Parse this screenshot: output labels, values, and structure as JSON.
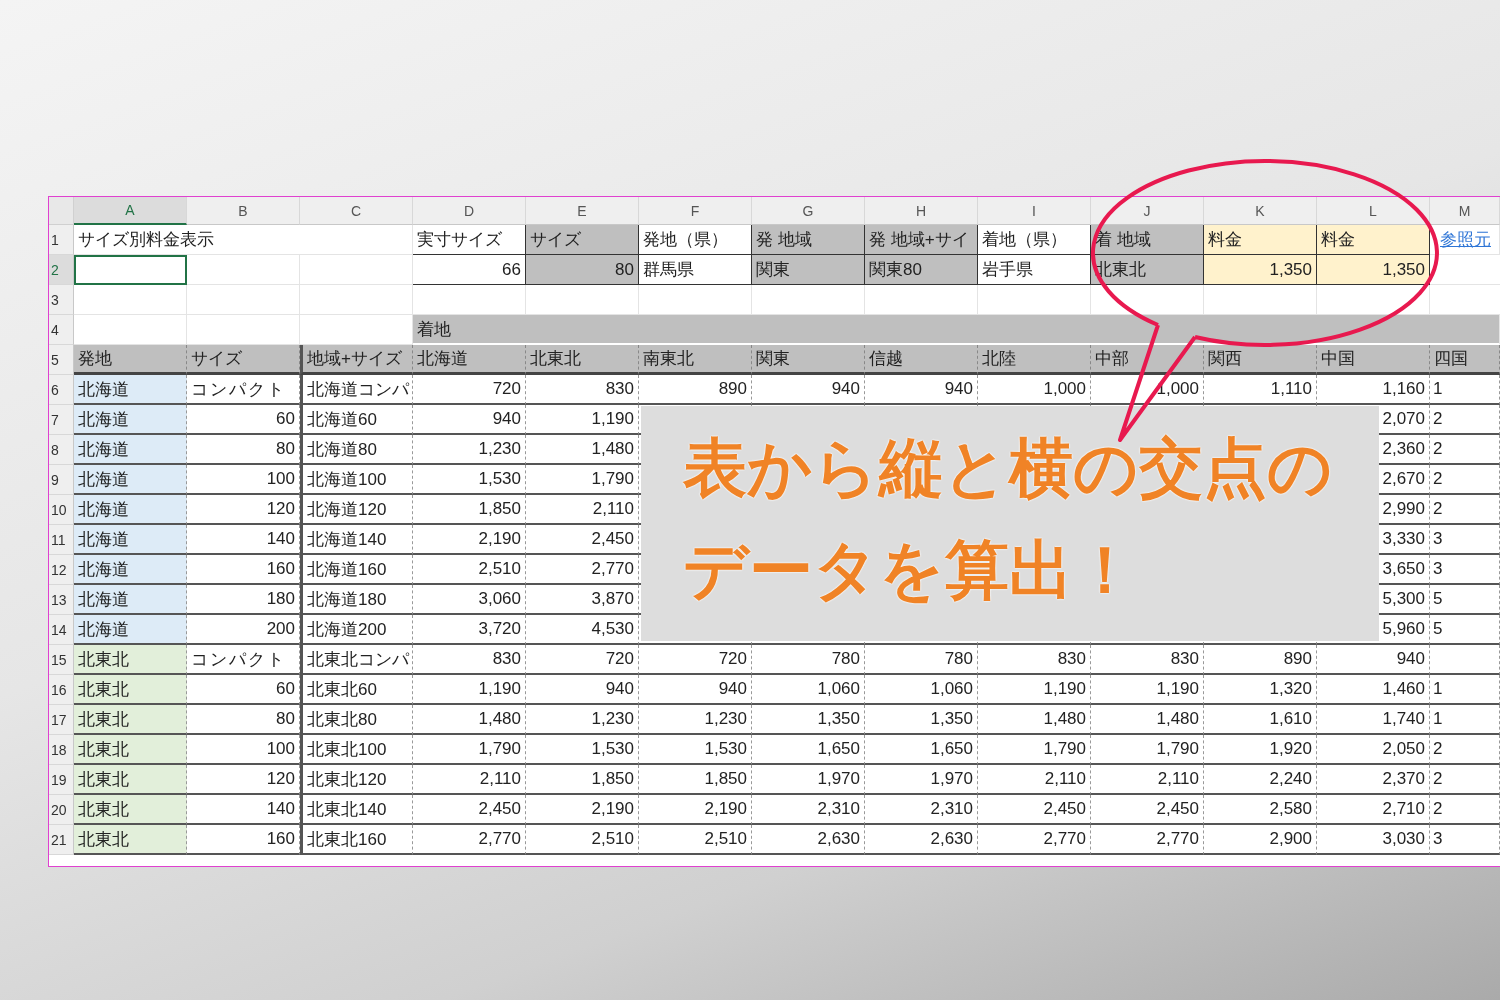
{
  "columns": [
    {
      "label": "A",
      "selected": true
    },
    {
      "label": "B",
      "selected": false
    },
    {
      "label": "C",
      "selected": false
    },
    {
      "label": "D",
      "selected": false
    },
    {
      "label": "E",
      "selected": false
    },
    {
      "label": "F",
      "selected": false
    },
    {
      "label": "G",
      "selected": false
    },
    {
      "label": "H",
      "selected": false
    },
    {
      "label": "I",
      "selected": false
    },
    {
      "label": "J",
      "selected": false
    },
    {
      "label": "K",
      "selected": false
    },
    {
      "label": "L",
      "selected": false
    },
    {
      "label": "M",
      "selected": false
    }
  ],
  "top_rows": [
    {
      "num": "1",
      "selected": false,
      "cells": [
        {
          "kind": "title",
          "text": "サイズ別料金表示"
        },
        {
          "kind": "blank"
        },
        {
          "kind": "blank"
        },
        {
          "kind": "input",
          "text": "実寸サイズ"
        },
        {
          "kind": "lookup",
          "text": "サイズ"
        },
        {
          "kind": "input",
          "text": "発地（県）"
        },
        {
          "kind": "lookup",
          "text": "発 地域"
        },
        {
          "kind": "lookup",
          "text": "発 地域+サイ"
        },
        {
          "kind": "input",
          "text": "着地（県）"
        },
        {
          "kind": "lookup",
          "text": "着 地域"
        },
        {
          "kind": "fare",
          "text": "料金"
        },
        {
          "kind": "fare",
          "text": "料金"
        },
        {
          "kind": "link",
          "text": "参照元"
        }
      ]
    },
    {
      "num": "2",
      "selected": true,
      "cells": [
        {
          "kind": "blank"
        },
        {
          "kind": "blank"
        },
        {
          "kind": "blank"
        },
        {
          "kind": "input-number",
          "text": "66"
        },
        {
          "kind": "lookup-number",
          "text": "80"
        },
        {
          "kind": "input",
          "text": "群馬県"
        },
        {
          "kind": "lookup",
          "text": "関東"
        },
        {
          "kind": "lookup",
          "text": "関東80"
        },
        {
          "kind": "input",
          "text": "岩手県"
        },
        {
          "kind": "lookup",
          "text": "北東北"
        },
        {
          "kind": "fare-number",
          "text": "1,350"
        },
        {
          "kind": "fare-number",
          "text": "1,350"
        },
        {
          "kind": "blank"
        }
      ]
    },
    {
      "num": "3",
      "selected": false,
      "cells": []
    },
    {
      "num": "4",
      "selected": false,
      "cells": [
        {
          "kind": "blank"
        },
        {
          "kind": "blank"
        },
        {
          "kind": "blank"
        },
        {
          "kind": "band",
          "text": "着地"
        }
      ]
    },
    {
      "num": "5",
      "selected": false,
      "cells": [
        {
          "kind": "head",
          "text": "発地"
        },
        {
          "kind": "head",
          "text": "サイズ"
        },
        {
          "kind": "head",
          "text": "地域+サイズ"
        },
        {
          "kind": "head",
          "text": "北海道"
        },
        {
          "kind": "head",
          "text": "北東北"
        },
        {
          "kind": "head",
          "text": "南東北"
        },
        {
          "kind": "head",
          "text": "関東"
        },
        {
          "kind": "head",
          "text": "信越"
        },
        {
          "kind": "head",
          "text": "北陸"
        },
        {
          "kind": "head",
          "text": "中部"
        },
        {
          "kind": "head",
          "text": "関西"
        },
        {
          "kind": "head",
          "text": "中国"
        },
        {
          "kind": "head",
          "text": "四国"
        }
      ]
    }
  ],
  "rows": [
    {
      "num": "6",
      "selected": false,
      "origin": "北海道",
      "color": "#ddebf7",
      "size": "コンパクト",
      "kind": "compact",
      "key": "北海道コンパ",
      "fares": [
        "720",
        "830",
        "890",
        "940",
        "940",
        "1,000",
        "1,000",
        "1,110",
        "1,160",
        "1"
      ]
    },
    {
      "num": "7",
      "selected": false,
      "origin": "北海道",
      "color": "#ddebf7",
      "size": "60",
      "kind": "sized",
      "key": "北海道60",
      "fares": [
        "940",
        "1,190"
      ],
      "fares_after": [
        "2,070",
        "2"
      ]
    },
    {
      "num": "8",
      "selected": false,
      "origin": "北海道",
      "color": "#ddebf7",
      "size": "80",
      "kind": "sized",
      "key": "北海道80",
      "fares": [
        "1,230",
        "1,480"
      ],
      "fares_after": [
        "2,360",
        "2"
      ]
    },
    {
      "num": "9",
      "selected": false,
      "origin": "北海道",
      "color": "#ddebf7",
      "size": "100",
      "kind": "sized",
      "key": "北海道100",
      "fares": [
        "1,530",
        "1,790"
      ],
      "fares_after": [
        "2,670",
        "2"
      ]
    },
    {
      "num": "10",
      "selected": false,
      "origin": "北海道",
      "color": "#ddebf7",
      "size": "120",
      "kind": "sized",
      "key": "北海道120",
      "fares": [
        "1,850",
        "2,110"
      ],
      "fares_after": [
        "2,990",
        "2"
      ]
    },
    {
      "num": "11",
      "selected": false,
      "origin": "北海道",
      "color": "#ddebf7",
      "size": "140",
      "kind": "sized",
      "key": "北海道140",
      "fares": [
        "2,190",
        "2,450"
      ],
      "fares_after": [
        "3,330",
        "3"
      ]
    },
    {
      "num": "12",
      "selected": false,
      "origin": "北海道",
      "color": "#ddebf7",
      "size": "160",
      "kind": "sized",
      "key": "北海道160",
      "fares": [
        "2,510",
        "2,770"
      ],
      "fares_after": [
        "3,650",
        "3"
      ]
    },
    {
      "num": "13",
      "selected": false,
      "origin": "北海道",
      "color": "#ddebf7",
      "size": "180",
      "kind": "sized",
      "key": "北海道180",
      "fares": [
        "3,060",
        "3,870"
      ],
      "fares_after": [
        "5,300",
        "5"
      ]
    },
    {
      "num": "14",
      "selected": false,
      "origin": "北海道",
      "color": "#ddebf7",
      "size": "200",
      "kind": "sized",
      "key": "北海道200",
      "fares": [
        "3,720",
        "4,530"
      ],
      "fares_after": [
        "5,960",
        "5"
      ]
    },
    {
      "num": "15",
      "selected": false,
      "origin": "北東北",
      "color": "#e2efda",
      "size": "コンパクト",
      "kind": "compact",
      "key": "北東北コンパ",
      "fares": [
        "830",
        "720",
        "720",
        "780",
        "780",
        "830",
        "830",
        "890",
        "940"
      ]
    },
    {
      "num": "16",
      "selected": false,
      "origin": "北東北",
      "color": "#e2efda",
      "size": "60",
      "kind": "sized",
      "key": "北東北60",
      "fares": [
        "1,190",
        "940",
        "940",
        "1,060",
        "1,060",
        "1,190",
        "1,190",
        "1,320",
        "1,460",
        "1"
      ]
    },
    {
      "num": "17",
      "selected": false,
      "origin": "北東北",
      "color": "#e2efda",
      "size": "80",
      "kind": "sized",
      "key": "北東北80",
      "fares": [
        "1,480",
        "1,230",
        "1,230",
        "1,350",
        "1,350",
        "1,480",
        "1,480",
        "1,610",
        "1,740",
        "1"
      ]
    },
    {
      "num": "18",
      "selected": false,
      "origin": "北東北",
      "color": "#e2efda",
      "size": "100",
      "kind": "sized",
      "key": "北東北100",
      "fares": [
        "1,790",
        "1,530",
        "1,530",
        "1,650",
        "1,650",
        "1,790",
        "1,790",
        "1,920",
        "2,050",
        "2"
      ]
    },
    {
      "num": "19",
      "selected": false,
      "origin": "北東北",
      "color": "#e2efda",
      "size": "120",
      "kind": "sized",
      "key": "北東北120",
      "fares": [
        "2,110",
        "1,850",
        "1,850",
        "1,970",
        "1,970",
        "2,110",
        "2,110",
        "2,240",
        "2,370",
        "2"
      ]
    },
    {
      "num": "20",
      "selected": false,
      "origin": "北東北",
      "color": "#e2efda",
      "size": "140",
      "kind": "sized",
      "key": "北東北140",
      "fares": [
        "2,450",
        "2,190",
        "2,190",
        "2,310",
        "2,310",
        "2,450",
        "2,450",
        "2,580",
        "2,710",
        "2"
      ]
    },
    {
      "num": "21",
      "selected": false,
      "origin": "北東北",
      "color": "#e2efda",
      "size": "160",
      "kind": "sized",
      "key": "北東北160",
      "fares": [
        "2,770",
        "2,510",
        "2,510",
        "2,630",
        "2,630",
        "2,770",
        "2,770",
        "2,900",
        "3,030",
        "3"
      ]
    }
  ],
  "callout_lines": [
    "表から縦と横の交点の",
    "データを算出！"
  ]
}
